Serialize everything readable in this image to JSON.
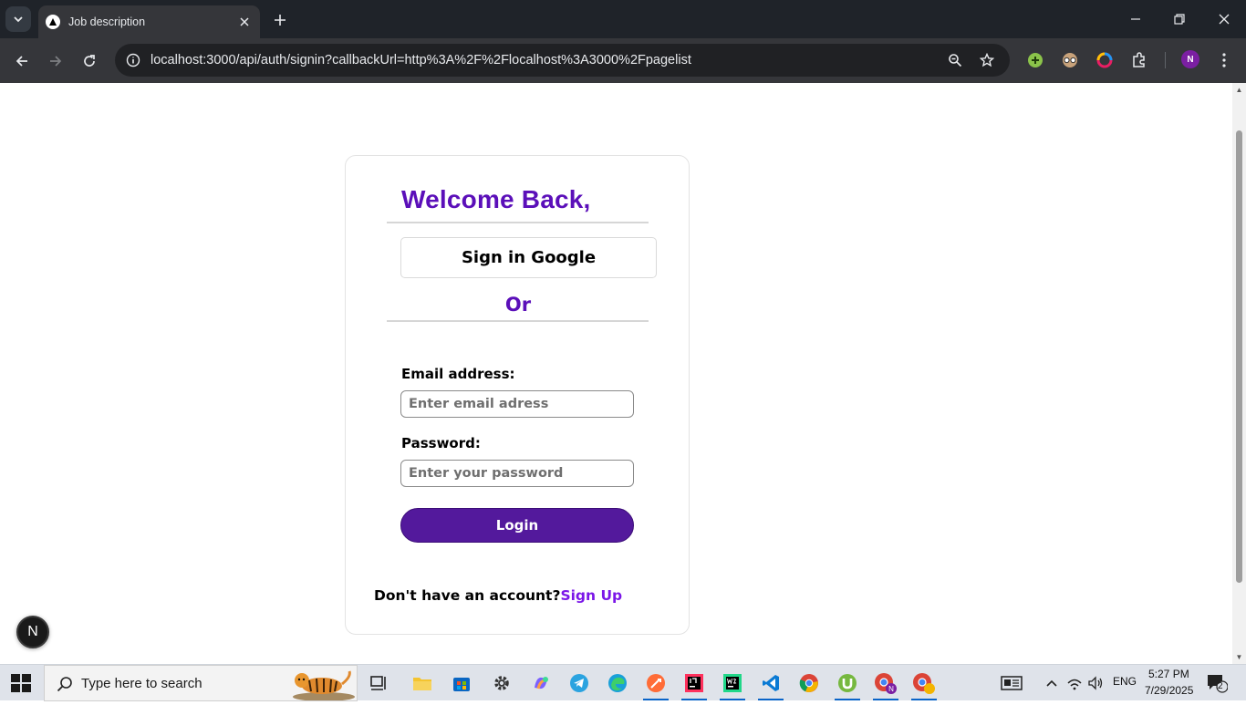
{
  "browser": {
    "tab_title": "Job description",
    "url": "localhost:3000/api/auth/signin?callbackUrl=http%3A%2F%2Flocalhost%3A3000%2Fpagelist",
    "profile_initial": "N"
  },
  "signin": {
    "heading": "Welcome Back,",
    "google_button": "Sign in Google",
    "divider_text": "Or",
    "email_label": "Email address:",
    "email_placeholder": "Enter email adress",
    "password_label": "Password:",
    "password_placeholder": "Enter your password",
    "login_button": "Login",
    "signup_prompt": "Don't have an account?",
    "signup_link": "Sign Up"
  },
  "dev_badge": "N",
  "taskbar": {
    "search_placeholder": "Type here to search",
    "language": "ENG",
    "time": "5:27 PM",
    "date": "7/29/2025",
    "notification_count": "2"
  },
  "colors": {
    "accent_purple": "#5b0fb9",
    "button_purple": "#53199c",
    "link_purple": "#7b16e8",
    "chrome_dark": "#35363a"
  }
}
